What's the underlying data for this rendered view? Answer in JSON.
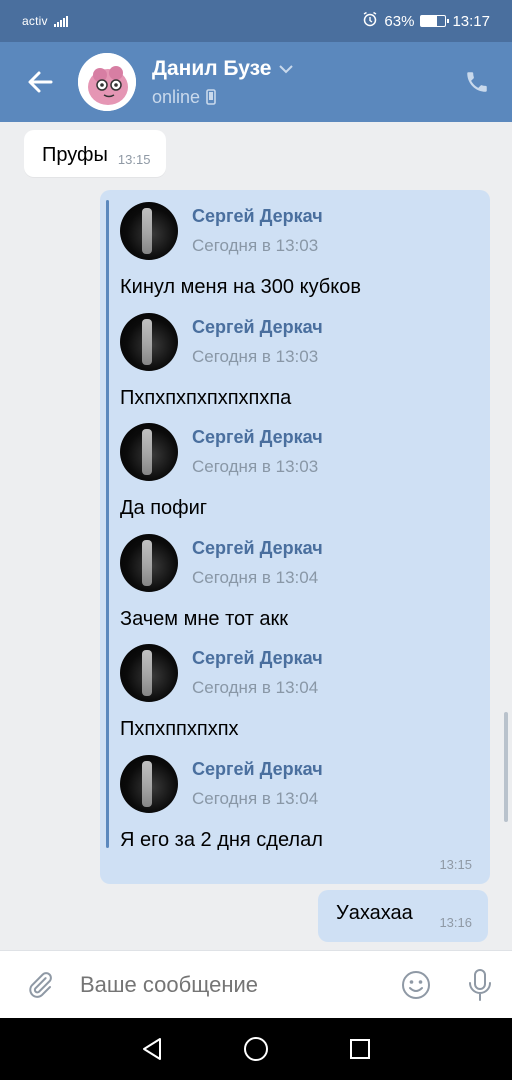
{
  "status_bar": {
    "carrier": "activ",
    "battery": "63%",
    "battery_level": 0.63,
    "time": "13:17"
  },
  "header": {
    "contact_name": "Данил Бузе",
    "status": "online",
    "icons": [
      "back-arrow-icon",
      "chevron-down-icon",
      "mobile-phone-icon",
      "phone-icon"
    ]
  },
  "messages": {
    "incoming": {
      "text": "Пруфы",
      "time": "13:15"
    },
    "forwarded": {
      "time": "13:15",
      "items": [
        {
          "author": "Сергей Деркач",
          "date": "Сегодня в 13:03",
          "text": "Кинул меня на 300 кубков"
        },
        {
          "author": "Сергей Деркач",
          "date": "Сегодня в 13:03",
          "text": "Пхпхпхпхпхпхпхпа"
        },
        {
          "author": "Сергей Деркач",
          "date": "Сегодня в 13:03",
          "text": "Да пофиг"
        },
        {
          "author": "Сергей Деркач",
          "date": "Сегодня в 13:04",
          "text": "Зачем мне тот акк"
        },
        {
          "author": "Сергей Деркач",
          "date": "Сегодня в 13:04",
          "text": "Пхпхппхпхпх"
        },
        {
          "author": "Сергей Деркач",
          "date": "Сегодня в 13:04",
          "text": "Я его за 2 дня сделал"
        }
      ]
    },
    "outgoing": {
      "text": "Уахахаа",
      "time": "13:16"
    }
  },
  "input": {
    "placeholder": "Ваше сообщение"
  },
  "colors": {
    "header": "#5b88bd",
    "status_bar": "#4a6f9e",
    "bubble_out": "#cfe0f4",
    "author": "#4a6f9e"
  }
}
